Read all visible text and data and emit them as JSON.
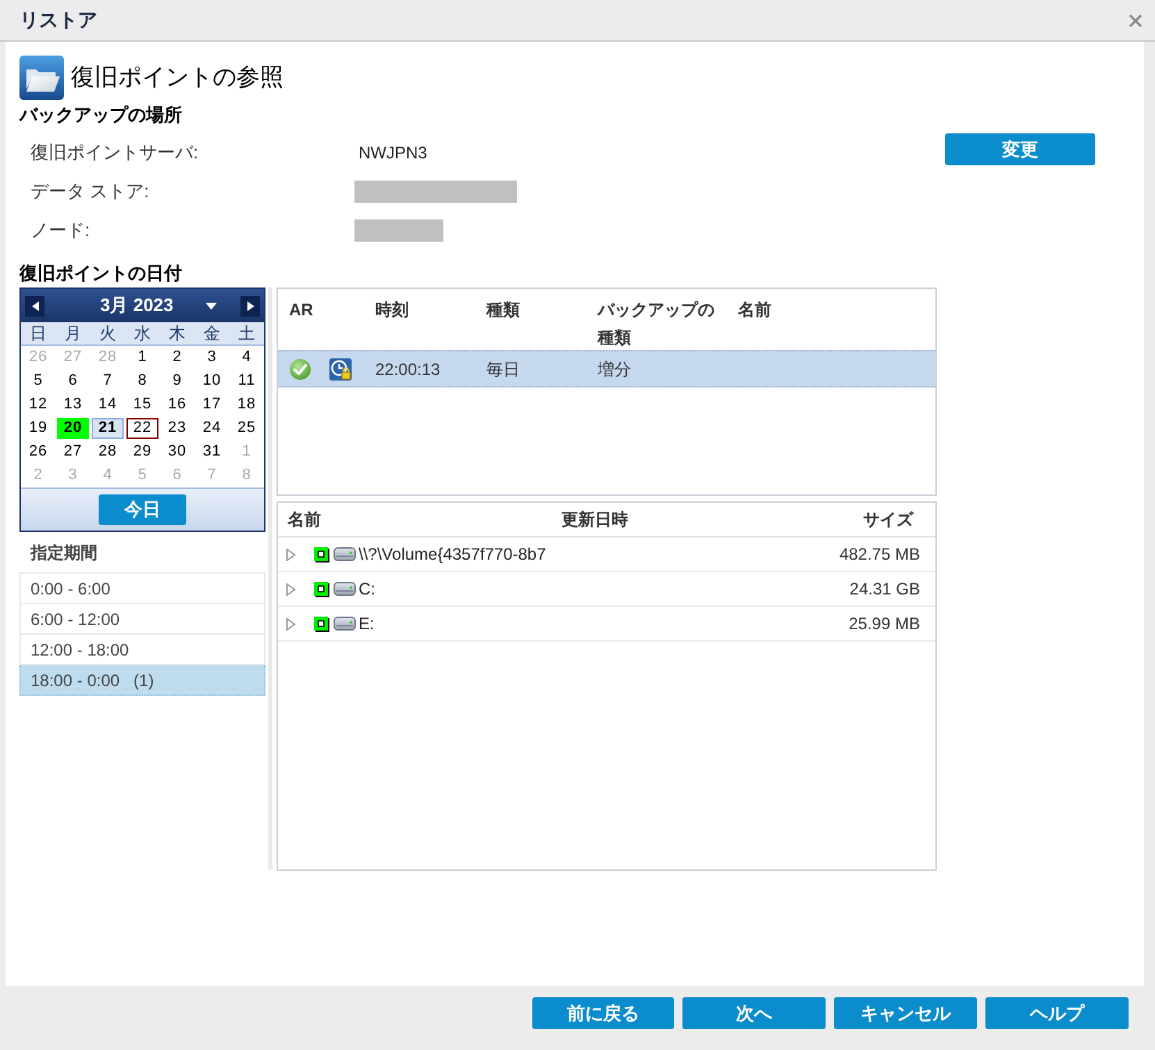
{
  "window": {
    "title": "リストア"
  },
  "header": {
    "title": "復旧ポイントの参照"
  },
  "backup_location": {
    "heading": "バックアップの場所",
    "fields": [
      {
        "label": "復旧ポイントサーバ:",
        "value": "NWJPN3",
        "redacted": false
      },
      {
        "label": "データ ストア:",
        "redacted": true
      },
      {
        "label": "ノード:",
        "redacted": true
      }
    ],
    "change_button": "変更"
  },
  "date_section": {
    "heading": "復旧ポイントの日付"
  },
  "calendar": {
    "month": "3月 2023",
    "weekdays": [
      "日",
      "月",
      "火",
      "水",
      "木",
      "金",
      "土"
    ],
    "weeks": [
      [
        {
          "day": "26",
          "outside": true,
          "has_points": false,
          "selected": false,
          "today": false
        },
        {
          "day": "27",
          "outside": true,
          "has_points": false,
          "selected": false,
          "today": false
        },
        {
          "day": "28",
          "outside": true,
          "has_points": false,
          "selected": false,
          "today": false
        },
        {
          "day": "1",
          "outside": false,
          "has_points": false,
          "selected": false,
          "today": false
        },
        {
          "day": "2",
          "outside": false,
          "has_points": false,
          "selected": false,
          "today": false
        },
        {
          "day": "3",
          "outside": false,
          "has_points": false,
          "selected": false,
          "today": false
        },
        {
          "day": "4",
          "outside": false,
          "has_points": false,
          "selected": false,
          "today": false
        }
      ],
      [
        {
          "day": "5",
          "outside": false,
          "has_points": false,
          "selected": false,
          "today": false
        },
        {
          "day": "6",
          "outside": false,
          "has_points": false,
          "selected": false,
          "today": false
        },
        {
          "day": "7",
          "outside": false,
          "has_points": false,
          "selected": false,
          "today": false
        },
        {
          "day": "8",
          "outside": false,
          "has_points": false,
          "selected": false,
          "today": false
        },
        {
          "day": "9",
          "outside": false,
          "has_points": false,
          "selected": false,
          "today": false
        },
        {
          "day": "10",
          "outside": false,
          "has_points": false,
          "selected": false,
          "today": false
        },
        {
          "day": "11",
          "outside": false,
          "has_points": false,
          "selected": false,
          "today": false
        }
      ],
      [
        {
          "day": "12",
          "outside": false,
          "has_points": false,
          "selected": false,
          "today": false
        },
        {
          "day": "13",
          "outside": false,
          "has_points": false,
          "selected": false,
          "today": false
        },
        {
          "day": "14",
          "outside": false,
          "has_points": false,
          "selected": false,
          "today": false
        },
        {
          "day": "15",
          "outside": false,
          "has_points": false,
          "selected": false,
          "today": false
        },
        {
          "day": "16",
          "outside": false,
          "has_points": false,
          "selected": false,
          "today": false
        },
        {
          "day": "17",
          "outside": false,
          "has_points": false,
          "selected": false,
          "today": false
        },
        {
          "day": "18",
          "outside": false,
          "has_points": false,
          "selected": false,
          "today": false
        }
      ],
      [
        {
          "day": "19",
          "outside": false,
          "has_points": false,
          "selected": false,
          "today": false
        },
        {
          "day": "20",
          "outside": false,
          "has_points": true,
          "selected": false,
          "today": false
        },
        {
          "day": "21",
          "outside": false,
          "has_points": true,
          "selected": true,
          "today": false
        },
        {
          "day": "22",
          "outside": false,
          "has_points": false,
          "selected": false,
          "today": true
        },
        {
          "day": "23",
          "outside": false,
          "has_points": false,
          "selected": false,
          "today": false
        },
        {
          "day": "24",
          "outside": false,
          "has_points": false,
          "selected": false,
          "today": false
        },
        {
          "day": "25",
          "outside": false,
          "has_points": false,
          "selected": false,
          "today": false
        }
      ],
      [
        {
          "day": "26",
          "outside": false,
          "has_points": false,
          "selected": false,
          "today": false
        },
        {
          "day": "27",
          "outside": false,
          "has_points": false,
          "selected": false,
          "today": false
        },
        {
          "day": "28",
          "outside": false,
          "has_points": false,
          "selected": false,
          "today": false
        },
        {
          "day": "29",
          "outside": false,
          "has_points": false,
          "selected": false,
          "today": false
        },
        {
          "day": "30",
          "outside": false,
          "has_points": false,
          "selected": false,
          "today": false
        },
        {
          "day": "31",
          "outside": false,
          "has_points": false,
          "selected": false,
          "today": false
        },
        {
          "day": "1",
          "outside": true,
          "has_points": false,
          "selected": false,
          "today": false
        }
      ],
      [
        {
          "day": "2",
          "outside": true,
          "has_points": false,
          "selected": false,
          "today": false
        },
        {
          "day": "3",
          "outside": true,
          "has_points": false,
          "selected": false,
          "today": false
        },
        {
          "day": "4",
          "outside": true,
          "has_points": false,
          "selected": false,
          "today": false
        },
        {
          "day": "5",
          "outside": true,
          "has_points": false,
          "selected": false,
          "today": false
        },
        {
          "day": "6",
          "outside": true,
          "has_points": false,
          "selected": false,
          "today": false
        },
        {
          "day": "7",
          "outside": true,
          "has_points": false,
          "selected": false,
          "today": false
        },
        {
          "day": "8",
          "outside": true,
          "has_points": false,
          "selected": false,
          "today": false
        }
      ]
    ],
    "today_button": "今日"
  },
  "time_ranges": {
    "heading": "指定期間",
    "items": [
      {
        "label": "0:00 - 6:00",
        "selected": false
      },
      {
        "label": "6:00 - 12:00",
        "selected": false
      },
      {
        "label": "12:00 - 18:00",
        "selected": false
      },
      {
        "label": "18:00 - 0:00   (1)",
        "selected": true
      }
    ]
  },
  "recovery_points": {
    "columns": [
      "AR",
      "時刻",
      "種類",
      "バックアップの種類",
      "名前"
    ],
    "rows": [
      {
        "ar_completed": true,
        "time": "22:00:13",
        "type": "毎日",
        "backup_type": "増分",
        "selected": true
      }
    ]
  },
  "files": {
    "columns": [
      "名前",
      "更新日時",
      "サイズ"
    ],
    "rows": [
      {
        "name": "\\\\?\\Volume{4357f770-8b7",
        "size": "482.75 MB",
        "expanded": false,
        "checked": true
      },
      {
        "name": "C:",
        "size": "24.31 GB",
        "expanded": false,
        "checked": true
      },
      {
        "name": "E:",
        "size": "25.99 MB",
        "expanded": false,
        "checked": true
      }
    ]
  },
  "buttons": [
    "前に戻る",
    "次へ",
    "キャンセル",
    "ヘルプ"
  ]
}
